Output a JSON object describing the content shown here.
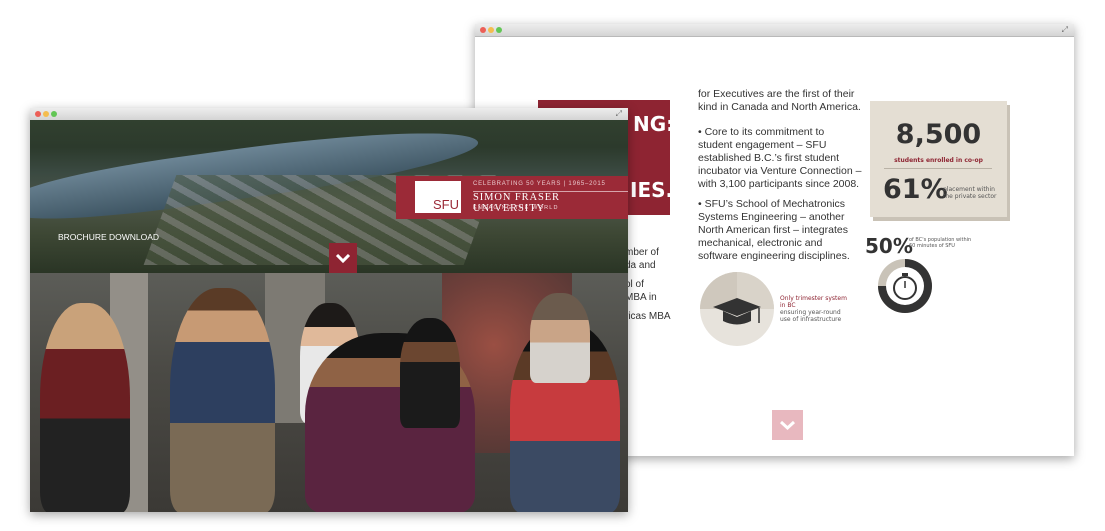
{
  "back_window": {
    "cut_heading_1": "NG:",
    "cut_heading_2": "IES.",
    "cut_left_text": [
      "mber of",
      "da and",
      "ol of",
      "MBA in",
      "ricas MBA"
    ],
    "para1": [
      "for Executives are the first of their",
      "kind in Canada and North America."
    ],
    "para2": [
      "• Core to its commitment to",
      "student engagement – SFU",
      "established B.C.’s first student",
      "incubator via Venture Connection –",
      "with 3,100 participants since 2008."
    ],
    "para3": [
      "• SFU’s School of Mechatronics",
      "Systems Engineering – another",
      "North American first – integrates",
      "mechanical, electronic and",
      "software engineering disciplines."
    ],
    "stat_students": "8,500",
    "stat_students_label": "students enrolled in co-op",
    "stat_placement": "61%",
    "stat_placement_label": "placement within the private sector",
    "stat_fifty": "50%",
    "stat_fifty_label": "of BC's population within 60 minutes of SFU",
    "trimester_note_red": "Only trimester system in BC",
    "trimester_note": "ensuring year-round use of infrastructure",
    "down_icon": "chevron-down-icon"
  },
  "front_window": {
    "celebrating": "CELEBRATING 50 YEARS | 1965–2015",
    "logo_text": "SFU",
    "university_name": "SIMON FRASER UNIVERSITY",
    "tagline": "ENGAGING THE WORLD",
    "brochure_link": "BROCHURE DOWNLOAD",
    "down_icon": "chevron-down-icon"
  },
  "colors": {
    "brand_red": "#8e2432",
    "card_beige": "#e4ded3",
    "pink_button": "#e8b8bf"
  }
}
